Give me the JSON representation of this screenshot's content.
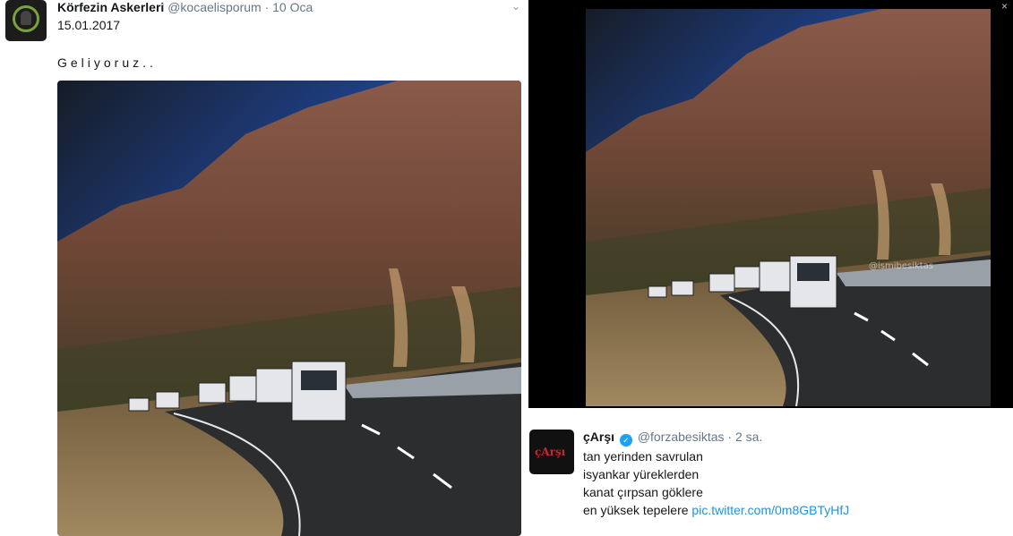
{
  "left_tweet": {
    "name": "Körfezin Askerleri",
    "handle": "@kocaelisporum",
    "time": "10 Oca",
    "date": "15.01.2017",
    "text": "Geliyoruz..",
    "caret": "⌄"
  },
  "right_tweet": {
    "name": "çArşı",
    "handle": "@forzabesiktas",
    "time": "2 sa.",
    "lines": [
      "tan yerinden savrulan",
      "isyankar yüreklerden",
      "kanat çırpsan göklere"
    ],
    "last_line_text": "en yüksek tepelere",
    "link": "pic.twitter.com/0m8GBTyHfJ",
    "avatar_mark": "çArşı"
  },
  "colors": {
    "link": "#1b95e0",
    "verified": "#1da1f2",
    "name_text": "#14171a",
    "muted_text": "#657786"
  },
  "icons": {
    "verified": "verified-badge-icon",
    "caret": "chevron-down-icon",
    "close": "close-icon"
  },
  "lightbox": {
    "close": "×"
  },
  "watermark": "@ismibesiktas"
}
